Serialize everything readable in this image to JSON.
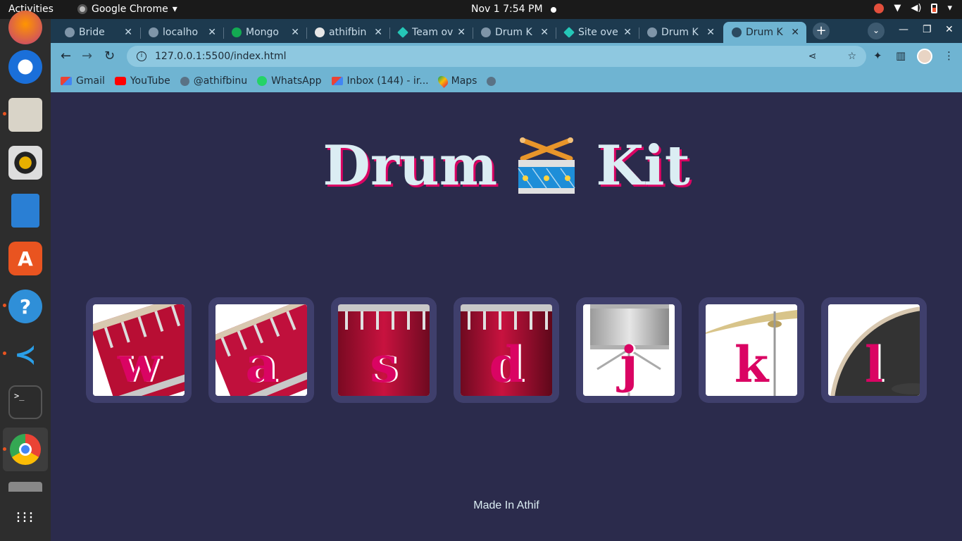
{
  "system": {
    "activities": "Activities",
    "app_name": "Google Chrome",
    "clock": "Nov 1   7:54 PM"
  },
  "tabs": [
    {
      "label": "Bride",
      "icon": "globe-icon"
    },
    {
      "label": "localho",
      "icon": "globe-icon"
    },
    {
      "label": "Mongo",
      "icon": "mongodb-icon"
    },
    {
      "label": "athifbin",
      "icon": "github-icon"
    },
    {
      "label": "Team ov",
      "icon": "netlify-icon"
    },
    {
      "label": "Drum K",
      "icon": "globe-icon"
    },
    {
      "label": "Site ove",
      "icon": "netlify-icon"
    },
    {
      "label": "Drum K",
      "icon": "globe-icon"
    },
    {
      "label": "Drum K",
      "icon": "globe-icon",
      "active": true
    }
  ],
  "toolbar": {
    "url": "127.0.0.1:5500/index.html"
  },
  "bookmarks": [
    {
      "label": "Gmail",
      "icon": "gmail-icon"
    },
    {
      "label": "YouTube",
      "icon": "youtube-icon"
    },
    {
      "label": "@athifbinu",
      "icon": "globe-icon"
    },
    {
      "label": "WhatsApp",
      "icon": "whatsapp-icon"
    },
    {
      "label": "Inbox (144) - ir...",
      "icon": "gmail-icon"
    },
    {
      "label": "Maps",
      "icon": "maps-icon"
    },
    {
      "label": "",
      "icon": "globe-icon"
    }
  ],
  "page": {
    "title_left": "Drum",
    "title_right": "Kit",
    "pads": [
      {
        "key": "w",
        "instrument": "tom-1"
      },
      {
        "key": "a",
        "instrument": "tom-2"
      },
      {
        "key": "s",
        "instrument": "tom-3"
      },
      {
        "key": "d",
        "instrument": "tom-4"
      },
      {
        "key": "j",
        "instrument": "snare"
      },
      {
        "key": "k",
        "instrument": "crash"
      },
      {
        "key": "l",
        "instrument": "kick"
      }
    ],
    "footer": "Made In Athif"
  },
  "colors": {
    "background": "#2b2b4c",
    "accent": "#da0463",
    "title": "#dbedf3",
    "pad_border": "#3f3f6c"
  }
}
